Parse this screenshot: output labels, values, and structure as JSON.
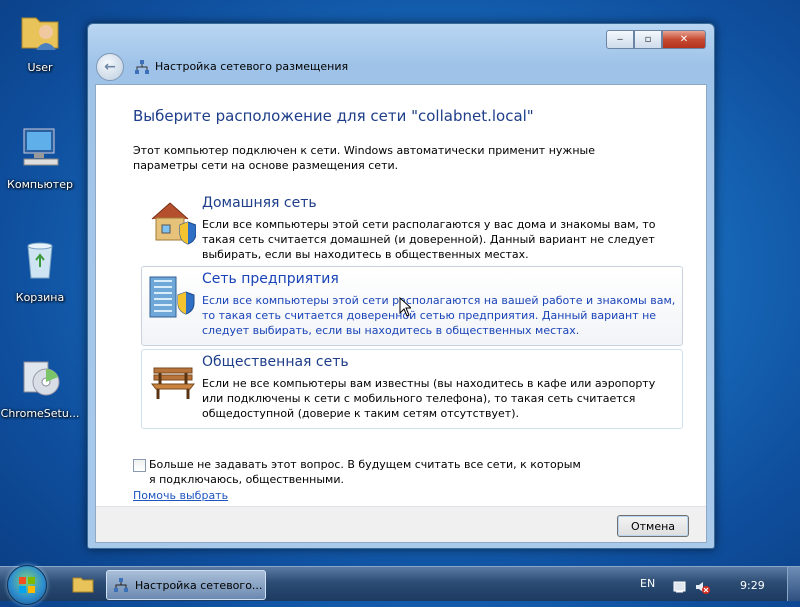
{
  "desktop": {
    "icons": [
      {
        "label": "User",
        "icon": "user-folder-icon"
      },
      {
        "label": "Компьютер",
        "icon": "computer-icon"
      },
      {
        "label": "Корзина",
        "icon": "recycle-bin-icon"
      },
      {
        "label": "ChromeSetu...",
        "icon": "installer-icon"
      }
    ]
  },
  "window": {
    "title": "Настройка сетевого размещения",
    "controls": {
      "minimize": "‒",
      "maximize": "▫",
      "close": "✕"
    },
    "heading": "Выберите расположение для сети \"collabnet.local\"",
    "intro": "Этот компьютер подключен к сети. Windows автоматически применит нужные параметры сети на основе размещения сети.",
    "options": [
      {
        "title": "Домашняя сеть",
        "description": "Если все компьютеры этой сети располагаются у вас дома и знакомы вам, то такая сеть считается домашней (и доверенной). Данный вариант не следует выбирать, если вы находитесь в общественных местах."
      },
      {
        "title": "Сеть предприятия",
        "description": "Если все компьютеры этой сети располагаются на вашей работе и знакомы вам, то такая сеть считается доверенной сетью предприятия. Данный вариант не следует выбирать, если вы находитесь в общественных местах."
      },
      {
        "title": "Общественная сеть",
        "description": "Если не все компьютеры вам известны (вы находитесь в кафе или аэропорту или подключены к сети с мобильного телефона), то такая сеть считается общедоступной (доверие к таким сетям отсутствует)."
      }
    ],
    "checkbox": {
      "label": "Больше не задавать этот вопрос. В будущем считать все сети, к которым я подключаюсь, общественными.",
      "checked": false
    },
    "help_link": "Помочь выбрать",
    "cancel_button": "Отмена"
  },
  "taskbar": {
    "task_label": "Настройка сетевого...",
    "language": "EN",
    "clock": "9:29"
  },
  "colors": {
    "heading": "#1e3e8a",
    "link": "#1e55c0",
    "hover_text": "#1a43b8"
  }
}
